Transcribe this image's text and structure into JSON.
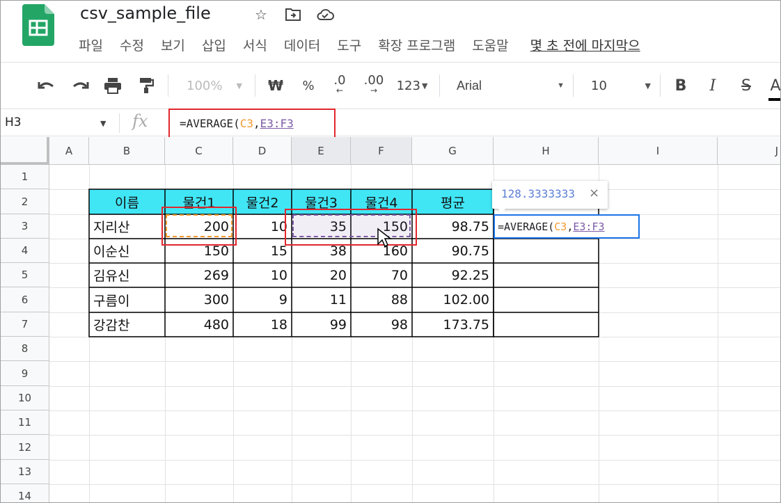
{
  "doc": {
    "title": "csv_sample_file"
  },
  "menu": [
    "파일",
    "수정",
    "보기",
    "삽입",
    "서식",
    "데이터",
    "도구",
    "확장 프로그램",
    "도움말"
  ],
  "last_edit": "몇 초 전에 마지막으",
  "toolbar": {
    "zoom": "100%",
    "currency": "₩",
    "percent": "%",
    "dec_decrease": ".0",
    "dec_increase": ".00",
    "format_more": "123",
    "font": "Arial",
    "font_size": "10",
    "bold": "B",
    "italic": "I",
    "strike": "S",
    "text_color": "A"
  },
  "formula_bar": {
    "name_box": "H3",
    "fx": "fx",
    "prefix": "=AVERAGE(",
    "ref1": "C3",
    "comma": ",",
    "ref2": "E3:F3"
  },
  "columns": [
    "A",
    "B",
    "C",
    "D",
    "E",
    "F",
    "G",
    "H",
    "I",
    "J"
  ],
  "rows": [
    "1",
    "2",
    "3",
    "4",
    "5",
    "6",
    "7",
    "8",
    "9",
    "10",
    "11",
    "12",
    "13",
    "14"
  ],
  "table": {
    "headers": [
      "이름",
      "물건1",
      "물건2",
      "물건3",
      "물건4",
      "평균"
    ],
    "rows": [
      [
        "지리산",
        "200",
        "10",
        "35",
        "150",
        "98.75"
      ],
      [
        "이순신",
        "150",
        "15",
        "38",
        "160",
        "90.75"
      ],
      [
        "김유신",
        "269",
        "10",
        "20",
        "70",
        "92.25"
      ],
      [
        "구름이",
        "300",
        "9",
        "11",
        "88",
        "102.00"
      ],
      [
        "강감찬",
        "480",
        "18",
        "99",
        "98",
        "173.75"
      ]
    ]
  },
  "editor": {
    "prefix": "=AVERAGE(",
    "ref1": "C3",
    "comma": ",",
    "ref2": "E3:F3"
  },
  "tooltip": {
    "value": "128.3333333",
    "close": "×"
  },
  "colors": {
    "header_fill": "#41e6f5",
    "ref_c": "#f29930",
    "ref_ef": "#7b5aa6",
    "highlight_red": "#e2272d",
    "editor_blue": "#1a73e8"
  }
}
